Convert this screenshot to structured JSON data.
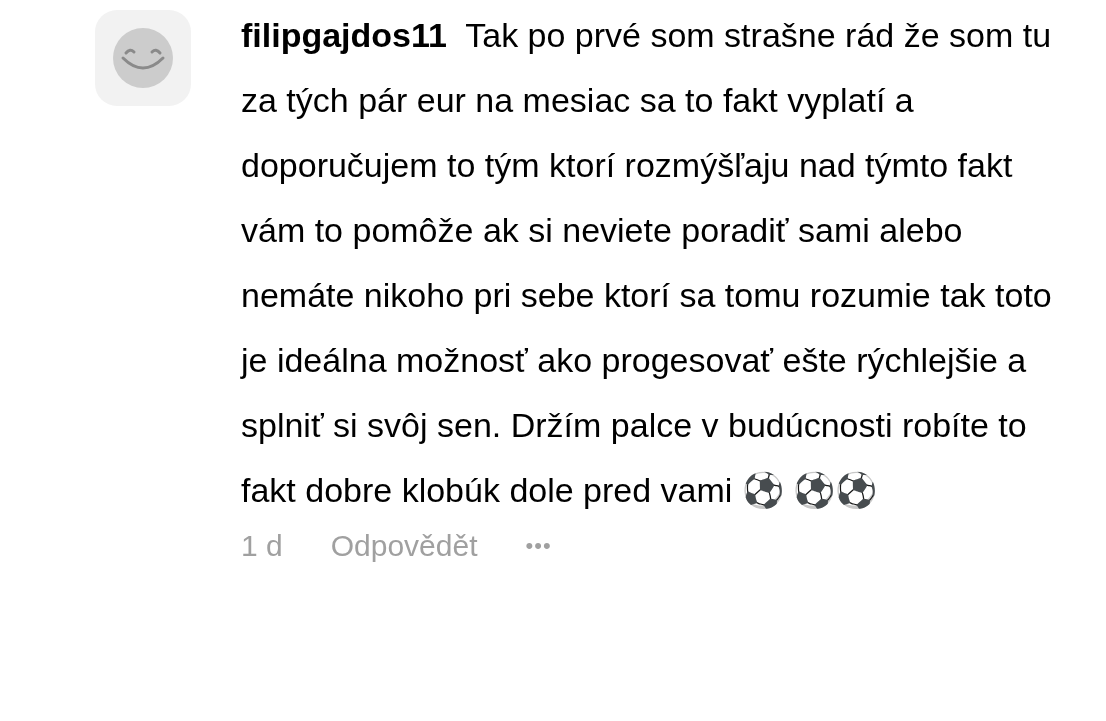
{
  "comment": {
    "username": "filipgajdos11",
    "text": "Tak po prvé som strašne rád že som tu za tých pár eur na mesiac sa to fakt vyplatí a doporučujem to tým ktorí rozmýšľaju nad týmto fakt vám to pomôže ak si neviete poradiť sami alebo nemáte nikoho pri sebe ktorí sa tomu rozumie tak toto je ideálna možnosť ako progesovať ešte rýchlejšie a splniť si svôj sen. Držím palce v budúcnosti robíte to fakt dobre klobúk dole pred vami ⚽ ⚽⚽",
    "time": "1 d",
    "reply": "Odpovědět",
    "more": "•••"
  }
}
